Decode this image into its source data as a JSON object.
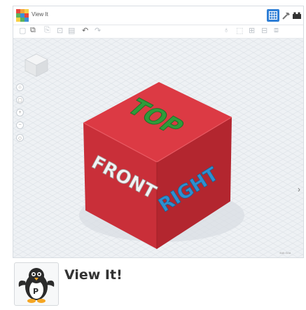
{
  "window": {
    "title": "View It"
  },
  "colors": {
    "accent": "#2f7fd6",
    "cube_red": "#d8333d",
    "top_text": "#2f9b3a",
    "front_text": "#f2f2f2",
    "right_text": "#2e8fd0"
  },
  "view_buttons": [
    {
      "icon": "grid-icon",
      "active": true
    },
    {
      "icon": "hammer-icon",
      "active": false
    },
    {
      "icon": "blocks-icon",
      "active": false
    }
  ],
  "cube": {
    "top": "TOP",
    "front": "FRONT",
    "right": "RIGHT"
  },
  "footer": {
    "label": "Edit Grid"
  },
  "app": {
    "name": "View It!"
  }
}
